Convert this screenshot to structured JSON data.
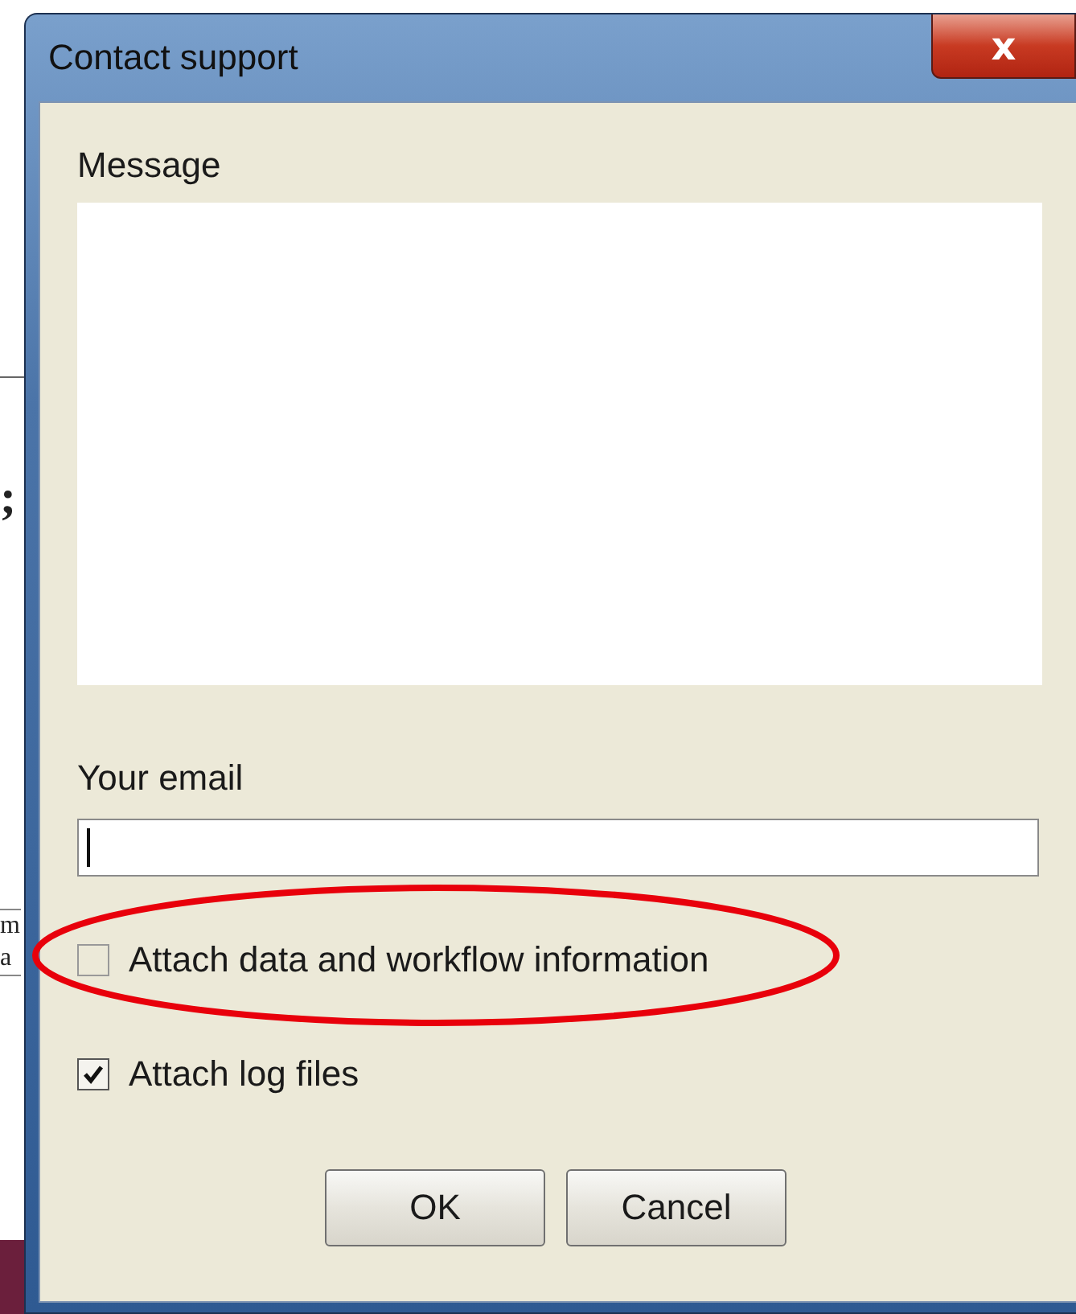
{
  "background_window": {
    "texts": [
      ";",
      "m",
      "a"
    ]
  },
  "window": {
    "title": "Contact support",
    "close_label": "x"
  },
  "message": {
    "label": "Message"
  },
  "email": {
    "label": "Your email",
    "focused": true
  },
  "checkboxes": [
    {
      "label": "Attach data and workflow information",
      "checked": false,
      "highlighted": true
    },
    {
      "label": "Attach log files",
      "checked": true,
      "highlighted": false
    }
  ],
  "buttons": [
    "OK",
    "Cancel"
  ]
}
